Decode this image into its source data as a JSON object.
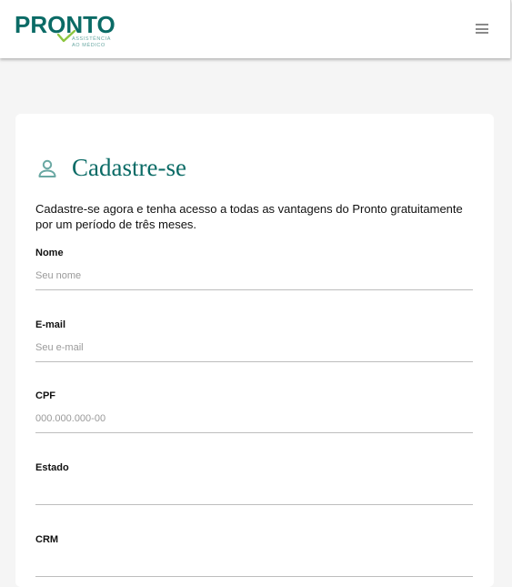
{
  "header": {
    "logo_word": "PRONTO",
    "logo_tagline_1": "ASSISTÊNCIA",
    "logo_tagline_2": "AO MÉDICO",
    "menu_icon": "hamburger-icon"
  },
  "colors": {
    "brand": "#0b6b66",
    "brand_light": "#6aa8a3",
    "check": "#8cc63f"
  },
  "form": {
    "title": "Cadastre-se",
    "title_icon": "user-icon",
    "intro": "Cadastre-se agora e tenha acesso a todas as vantagens do Pronto gratuitamente por um período de três meses.",
    "fields": [
      {
        "label": "Nome",
        "placeholder": "Seu nome"
      },
      {
        "label": "E-mail",
        "placeholder": "Seu e-mail"
      },
      {
        "label": "CPF",
        "placeholder": "000.000.000-00"
      },
      {
        "label": "Estado",
        "placeholder": ""
      },
      {
        "label": "CRM",
        "placeholder": ""
      }
    ]
  }
}
